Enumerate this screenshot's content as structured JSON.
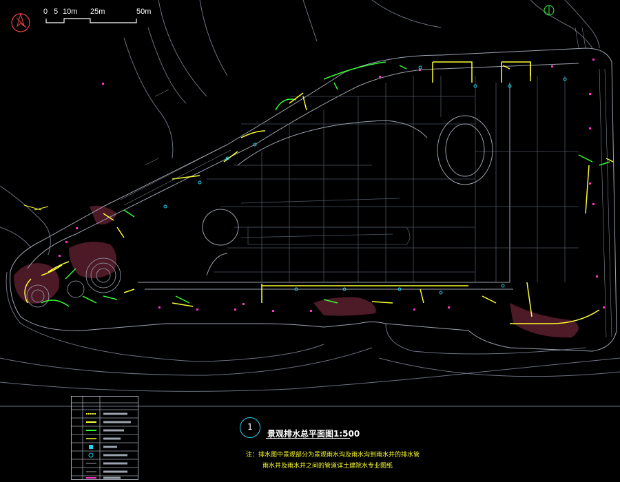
{
  "scale_bar": {
    "ticks": [
      "0",
      "5",
      "10m",
      "25m",
      "50m"
    ]
  },
  "title": {
    "number": "1",
    "text": "景观排水总平面图1:500"
  },
  "note": {
    "line1": "注：排水图中景观部分为景观雨水沟及雨水沟到雨水井的排水管",
    "line2": "雨水井及雨水井之间的管道详土建院水专业图纸"
  },
  "colors": {
    "background": "#000000",
    "base_lines": "#9ca3af",
    "drain_yellow": "#ffff33",
    "drain_green": "#33ff33",
    "marker_magenta": "#ff33cc",
    "marker_cyan": "#22d3ee",
    "landscape_maroon": "#5a1e2e",
    "north_red": "#ef4444"
  },
  "legend": {
    "rows": 10
  }
}
